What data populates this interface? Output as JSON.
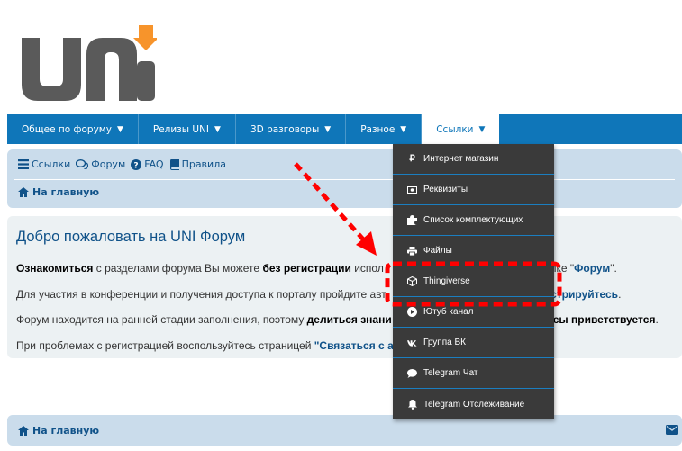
{
  "logo": {
    "text": "uni"
  },
  "nav": [
    {
      "label": "Общее по форуму",
      "caret": "▼"
    },
    {
      "label": "Релизы UNI",
      "caret": "▼"
    },
    {
      "label": "3D разговоры",
      "caret": "▼"
    },
    {
      "label": "Разное",
      "caret": "▼"
    },
    {
      "label": "Ссылки",
      "caret": "▼"
    }
  ],
  "quick_links": {
    "links": "Ссылки",
    "forum": "Форум",
    "faq": "FAQ",
    "rules": "Правила"
  },
  "breadcrumb": {
    "home": "На главную"
  },
  "welcome": {
    "title": "Добро пожаловать на UNI Форум",
    "line1": {
      "b1": "Ознакомиться",
      "t1": " с разделами форума Вы можете ",
      "b2": "без регистрации",
      "t2": " испол",
      "t3": "сылке \"",
      "link": "Форум",
      "t4": "\"."
    },
    "line2": {
      "t1": "Для участия в конференции и получения доступа к порталу пройдите авт",
      "link": "гистрируйтесь",
      "t2": "."
    },
    "line3": {
      "t1": "Форум находится на ранней стадии заполнения, поэтому ",
      "b1": "делиться знани",
      "b2": "сы приветствуется",
      "t2": "."
    },
    "line4": {
      "t1": "При проблемах с регистрацией воспользуйтесь страницей ",
      "b1": "\"Связаться с а"
    }
  },
  "dropdown": [
    {
      "icon": "ruble-icon",
      "label": "Интернет магазин"
    },
    {
      "icon": "money-icon",
      "label": "Реквизиты"
    },
    {
      "icon": "puzzle-icon",
      "label": "Список комплектующих"
    },
    {
      "icon": "printer-icon",
      "label": "Файлы"
    },
    {
      "icon": "cube-icon",
      "label": "Thingiverse"
    },
    {
      "icon": "play-icon",
      "label": "Ютуб канал"
    },
    {
      "icon": "vk-icon",
      "label": "Группа ВК"
    },
    {
      "icon": "chat-icon",
      "label": "Telegram Чат"
    },
    {
      "icon": "bell-icon",
      "label": "Telegram Отслеживание"
    }
  ],
  "colors": {
    "nav_bg": "#0f76b9",
    "link": "#105289",
    "panel": "#cadceb",
    "dropdown_bg": "#3a3a3a",
    "annotation": "#ff0000",
    "logo_gray": "#5a5a5a",
    "logo_orange": "#f7942b"
  }
}
